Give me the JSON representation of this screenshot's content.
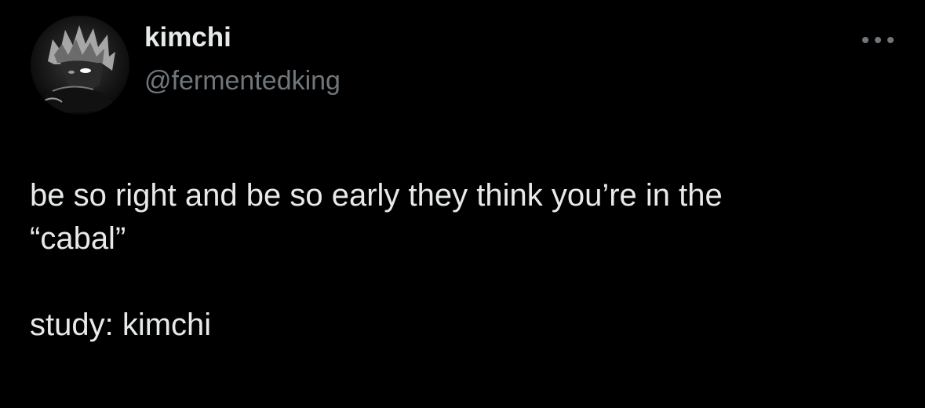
{
  "author": {
    "display_name": "kimchi",
    "handle": "@fermentedking",
    "avatar_icon": "anime-character-avatar-icon"
  },
  "tweet": {
    "lines": [
      "be so right and be so early they think you’re in the",
      "“cabal”",
      "",
      "study: kimchi"
    ]
  },
  "actions": {
    "more_icon": "more-options-icon"
  },
  "colors": {
    "background": "#000000",
    "primary_text": "#e7e9ea",
    "secondary_text": "#71767b"
  }
}
